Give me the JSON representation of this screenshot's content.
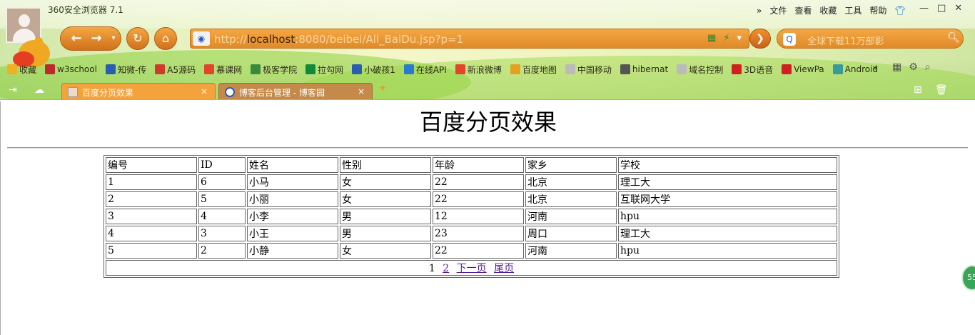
{
  "browser": {
    "app_title": "360安全浏览器 7.1",
    "menu": [
      "»",
      "文件",
      "查看",
      "收藏",
      "工具",
      "帮助"
    ],
    "url_host": "localhost",
    "url_rest": ":8080/beibei/All_BaiDu.jsp?p=1",
    "url_scheme": "http://",
    "search_placeholder": "全球下载11万部影",
    "bookmarks": [
      {
        "label": "收藏",
        "icon": "star-icon",
        "color": "#f0b020"
      },
      {
        "label": "w3school",
        "icon": "w3-icon",
        "color": "#c0282b"
      },
      {
        "label": "知微-传",
        "icon": "zhiwei-icon",
        "color": "#2a5db0"
      },
      {
        "label": "A5源码",
        "icon": "a5-icon",
        "color": "#d13a2a"
      },
      {
        "label": "慕课网",
        "icon": "flame-icon",
        "color": "#e2452a"
      },
      {
        "label": "极客学院",
        "icon": "jike-icon",
        "color": "#3b8a3b"
      },
      {
        "label": "拉勾网",
        "icon": "lagou-icon",
        "color": "#138a3b"
      },
      {
        "label": "小破孩1",
        "icon": "cycle-icon",
        "color": "#2a5db0"
      },
      {
        "label": "在线API",
        "icon": "c-icon",
        "color": "#2a7ad0"
      },
      {
        "label": "新浪微博",
        "icon": "weibo-icon",
        "color": "#e2452a"
      },
      {
        "label": "百度地图",
        "icon": "baidu-map-icon",
        "color": "#e5a020"
      },
      {
        "label": "中国移动",
        "icon": "page-icon",
        "color": "#bbbbbb"
      },
      {
        "label": "hibernat",
        "icon": "hibernate-icon",
        "color": "#555555"
      },
      {
        "label": "域名控制",
        "icon": "page-icon",
        "color": "#bbbbbb"
      },
      {
        "label": "3D语音",
        "icon": "c-red-icon",
        "color": "#d02020"
      },
      {
        "label": "ViewPa",
        "icon": "c-red-icon",
        "color": "#d02020"
      },
      {
        "label": "Android",
        "icon": "android-icon",
        "color": "#3a9a9a"
      }
    ],
    "bookmarks_more": "»",
    "tabs": [
      {
        "label": "百度分页效果",
        "active": true
      },
      {
        "label": "博客后台管理 - 博客园",
        "active": false
      }
    ],
    "tab_close": "×",
    "side_badge": "55"
  },
  "page": {
    "title": "百度分页效果",
    "columns": [
      "编号",
      "ID",
      "姓名",
      "性别",
      "年龄",
      "家乡",
      "学校"
    ],
    "rows": [
      [
        "1",
        "6",
        "小马",
        "女",
        "22",
        "北京",
        "理工大"
      ],
      [
        "2",
        "5",
        "小丽",
        "女",
        "22",
        "北京",
        "互联网大学"
      ],
      [
        "3",
        "4",
        "小李",
        "男",
        "12",
        "河南",
        "hpu"
      ],
      [
        "4",
        "3",
        "小王",
        "男",
        "23",
        "周口",
        "理工大"
      ],
      [
        "5",
        "2",
        "小静",
        "女",
        "22",
        "河南",
        "hpu"
      ]
    ],
    "pager": {
      "current": "1",
      "page2": "2",
      "next": "下一页",
      "last": "尾页"
    }
  }
}
